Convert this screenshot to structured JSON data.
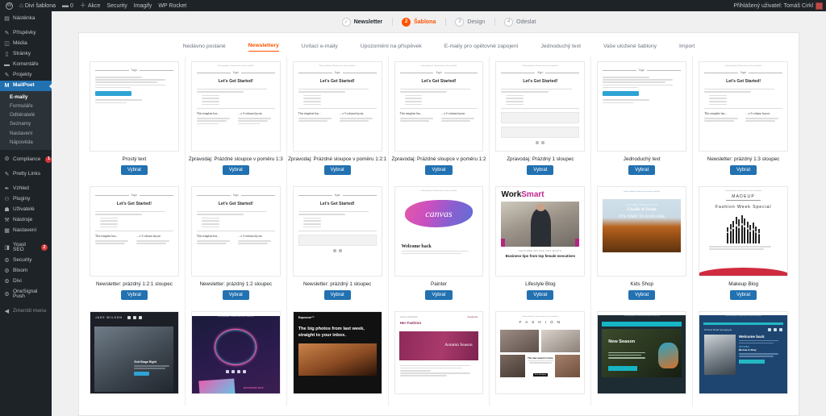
{
  "adminbar": {
    "wp_logo_icon": "wordpress-icon",
    "site_icon": "home-icon",
    "site_name": "Divi šablona",
    "comments_icon": "comment-icon",
    "comments_count": "0",
    "new_icon": "plus-icon",
    "new_label": "Akce",
    "items": [
      "Security",
      "Imagify",
      "WP Rocket"
    ],
    "account_label": "Přihlášený uživatel: Tomáš Cirkl",
    "avatar_icon": "avatar"
  },
  "sidebar": {
    "items": [
      {
        "label": "Nástěnka",
        "icon": "dashboard-icon"
      },
      {
        "label": "Příspěvky",
        "icon": "pin-icon",
        "gap_before": true
      },
      {
        "label": "Média",
        "icon": "media-icon"
      },
      {
        "label": "Stránky",
        "icon": "page-icon"
      },
      {
        "label": "Komentáře",
        "icon": "comment-icon"
      },
      {
        "label": "Projekty",
        "icon": "pin-icon"
      },
      {
        "label": "MailPoet",
        "icon": "mailpoet-icon",
        "current": true
      }
    ],
    "submenu": [
      {
        "label": "E-maily",
        "active": true
      },
      {
        "label": "Formuláře",
        "active": false
      },
      {
        "label": "Odběratelé",
        "active": false
      },
      {
        "label": "Seznamy",
        "active": false
      },
      {
        "label": "Nastavení",
        "active": false
      },
      {
        "label": "Nápověda",
        "active": false
      }
    ],
    "items_after": [
      {
        "label": "Compliance",
        "icon": "gear-icon",
        "badge": "1",
        "gap_before": true
      },
      {
        "label": "Pretty Links",
        "icon": "link-icon",
        "gap_before": true
      },
      {
        "label": "Vzhled",
        "icon": "brush-icon",
        "gap_before": true
      },
      {
        "label": "Pluginy",
        "icon": "plugin-icon"
      },
      {
        "label": "Uživatelé",
        "icon": "users-icon"
      },
      {
        "label": "Nástroje",
        "icon": "tools-icon"
      },
      {
        "label": "Nastavení",
        "icon": "settings-icon"
      },
      {
        "label": "Yoast SEO",
        "icon": "yoast-icon",
        "badge": "2",
        "gap_before": true
      },
      {
        "label": "Security",
        "icon": "gear-icon"
      },
      {
        "label": "Bloom",
        "icon": "gear-icon"
      },
      {
        "label": "Divi",
        "icon": "gear-icon"
      },
      {
        "label": "OneSignal Push",
        "icon": "gear-icon"
      },
      {
        "label": "Zmenšit menu",
        "icon": "collapse-icon",
        "dim": true,
        "gap_before": true
      }
    ]
  },
  "steps": [
    {
      "num": "✓",
      "label": "Newsletter",
      "state": "done"
    },
    {
      "num": "2",
      "label": "Šablona",
      "state": "active"
    },
    {
      "num": "3",
      "label": "Design",
      "state": "todo"
    },
    {
      "num": "4",
      "label": "Odeslat",
      "state": "todo"
    }
  ],
  "tabs": [
    {
      "label": "Nedávno poslané",
      "active": false
    },
    {
      "label": "Newslettery",
      "active": true
    },
    {
      "label": "Uvítací e-maily",
      "active": false
    },
    {
      "label": "Upozornění na příspěvek",
      "active": false
    },
    {
      "label": "E-maily pro opětovné zapojení",
      "active": false
    },
    {
      "label": "Jednoduchý text",
      "active": false
    },
    {
      "label": "Vaše uložené šablony",
      "active": false
    },
    {
      "label": "Import",
      "active": false
    }
  ],
  "select_label": "Vybrat",
  "templates": {
    "row1": [
      {
        "name": "Prostý text",
        "kind": "plaintext"
      },
      {
        "name": "Zpravodaj: Prázdné sloupce v poměru 1:3",
        "kind": "started3"
      },
      {
        "name": "Zpravodaj: Prázdné sloupce v poměru 1:2:1",
        "kind": "started3"
      },
      {
        "name": "Zpravodaj: Prázdné sloupce v poměru 1:2",
        "kind": "started2"
      },
      {
        "name": "Zpravodaj: Prázdný 1 sloupec",
        "kind": "started1"
      },
      {
        "name": "Jednoduchý text",
        "kind": "plaintext"
      },
      {
        "name": "Newsletter: prázdný 1:3 sloupec",
        "kind": "started3"
      }
    ],
    "row2": [
      {
        "name": "Newsletter: prázdný 1:2:1 sloupec",
        "kind": "started3"
      },
      {
        "name": "Newsletter: prázdný 1:2 sloupec",
        "kind": "started2"
      },
      {
        "name": "Newsletter: prázdný 1 sloupec",
        "kind": "started1"
      },
      {
        "name": "Painter",
        "kind": "painter"
      },
      {
        "name": "Lifestyle Blog",
        "kind": "worksmart"
      },
      {
        "name": "Kids Shop",
        "kind": "kids"
      },
      {
        "name": "Makeup Blog",
        "kind": "makeup"
      }
    ],
    "row3": [
      {
        "name": "",
        "kind": "jake"
      },
      {
        "name": "",
        "kind": "neon"
      },
      {
        "name": "",
        "kind": "exposure"
      },
      {
        "name": "",
        "kind": "herfashion"
      },
      {
        "name": "",
        "kind": "fashion"
      },
      {
        "name": "",
        "kind": "greenclean"
      },
      {
        "name": "",
        "kind": "synagogue"
      }
    ]
  },
  "thumb_text": {
    "preheader": "Potíže problémy? Zobrazit tento e-mail v prohlížeči",
    "logo_word": "logo",
    "heading_started": "Let's Get Started!",
    "col_left": "This template has...",
    "col_right": "... a 3-column layout.",
    "canvas_word": "canvas",
    "canvas_welcome": "Welcome back",
    "worksmart_a": "Work",
    "worksmart_b": "Smart",
    "worksmart_caption": "Business tips from top female executives",
    "worksmart_eyebrow": "FEATURED ARTICLE THIS MONTH",
    "kids_eyebrow": "AUTUMN TRENDS 2019",
    "kids_brand": "Charlie & Frank",
    "kids_headline": "IT'S TIME TO EXPLORE",
    "makeup_brand": "MADEUP",
    "makeup_headline": "Fashion Week Special",
    "jake_brand": "JAKE WILSON",
    "jake_headline": "Exit Stage Right",
    "exposure_brand": "Exposure™",
    "exposure_headline": "The big photos from last week, straight to your inbox.",
    "her_brand": "Her Fashion",
    "her_headline": "Autumn Season",
    "fashion_brand": "F A S H I O N",
    "fashion_badge": "The new season is here",
    "green_headline": "New Season",
    "syn_headline": "Welcome back"
  },
  "colors": {
    "accent": "#ff5301",
    "admin_blue": "#2271b1",
    "sidebar_bg": "#1d2327",
    "submenu_bg": "#2c3338"
  }
}
